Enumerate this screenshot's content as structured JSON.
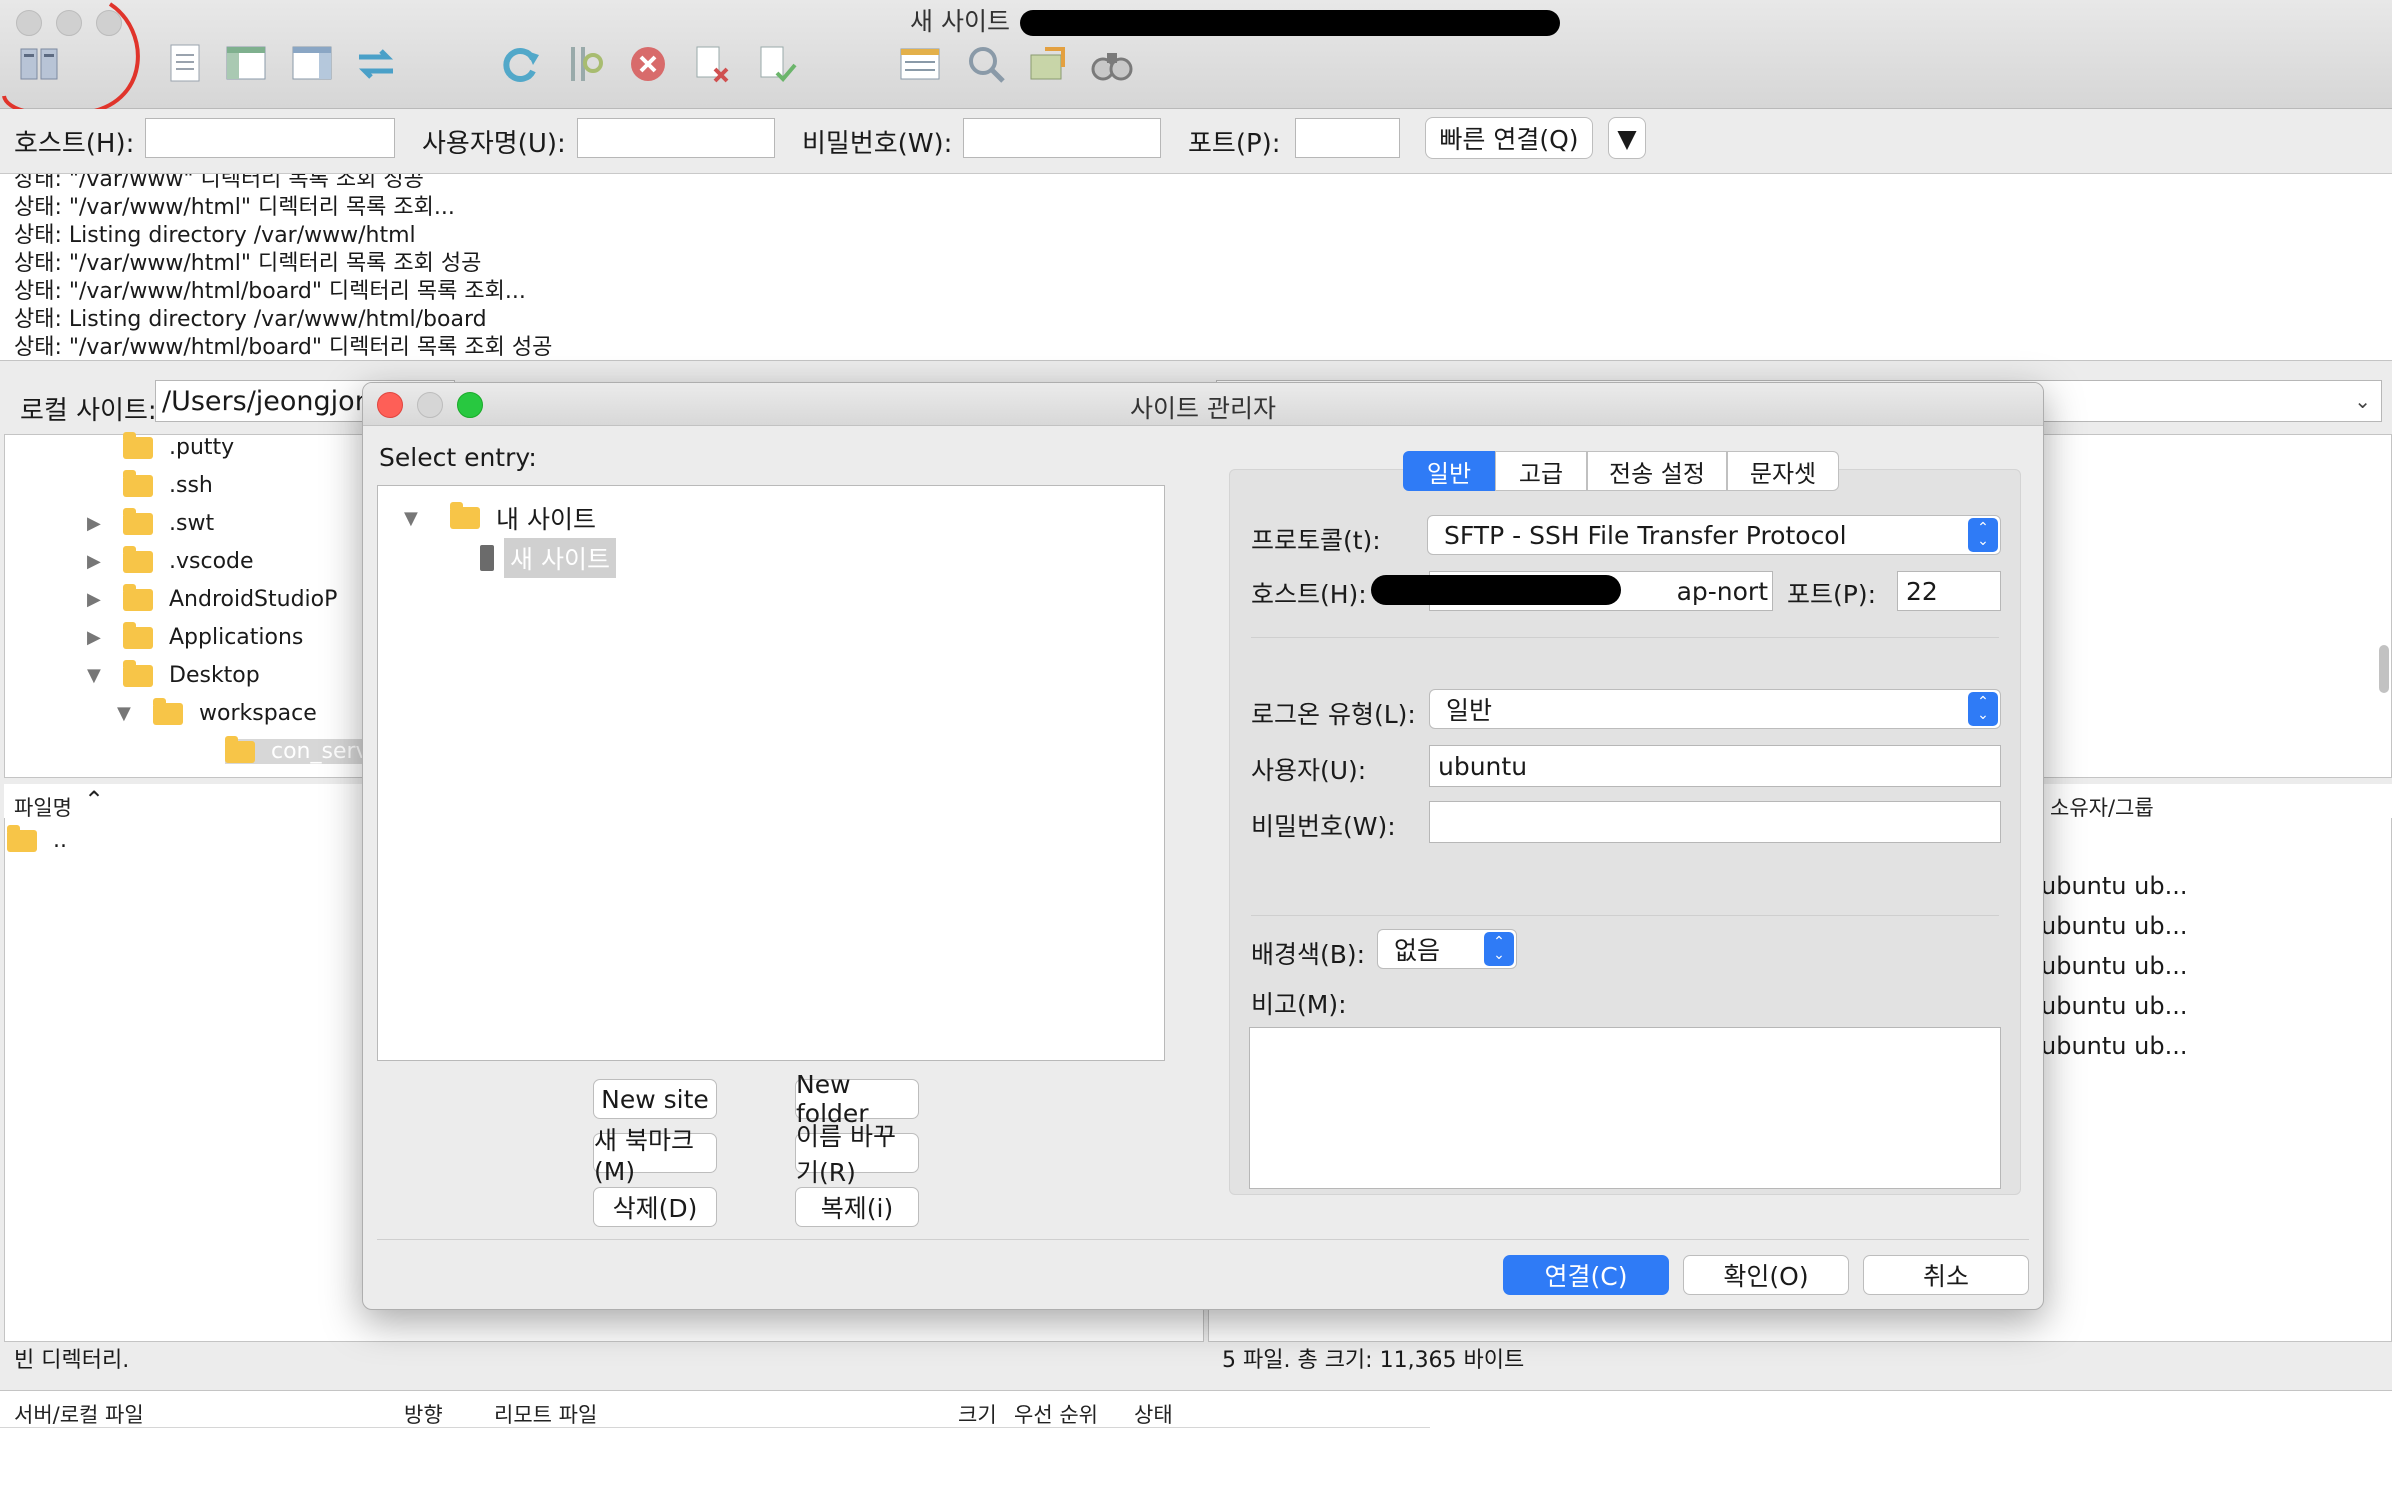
{
  "window": {
    "title": "새 사이트"
  },
  "toolbar": {
    "icons": [
      "site-manager-icon",
      "message-log-icon",
      "local-tree-icon",
      "remote-tree-icon",
      "transfer-queue-icon",
      "refresh-icon",
      "process-queue-icon",
      "cancel-icon",
      "disconnect-icon",
      "reconnect-icon",
      "directory-listing-filter-icon",
      "compare-icon",
      "sync-browse-icon",
      "find-files-icon"
    ]
  },
  "quickconnect": {
    "host_label": "호스트(H):",
    "user_label": "사용자명(U):",
    "password_label": "비밀번호(W):",
    "port_label": "포트(P):",
    "connect_button": "빠른 연결(Q)",
    "host_value": "",
    "user_value": "",
    "password_value": "",
    "port_value": ""
  },
  "log": [
    "상태:  \"/var/www\" 디렉터리 목록 조회 성공",
    "상태:  \"/var/www/html\" 디렉터리 목록 조회...",
    "상태:  Listing directory /var/www/html",
    "상태:  \"/var/www/html\" 디렉터리 목록 조회 성공",
    "상태:  \"/var/www/html/board\" 디렉터리 목록 조회...",
    "상태:  Listing directory /var/www/html/board",
    "상태:  \"/var/www/html/board\" 디렉터리 목록 조회 성공"
  ],
  "local": {
    "site_label": "로컬 사이트:",
    "path": "/Users/jeongjong",
    "tree": [
      {
        "label": ".putty",
        "arrow": ""
      },
      {
        "label": ".ssh",
        "arrow": ""
      },
      {
        "label": ".swt",
        "arrow": "▶"
      },
      {
        "label": ".vscode",
        "arrow": "▶"
      },
      {
        "label": "AndroidStudioP",
        "arrow": "▶"
      },
      {
        "label": "Applications",
        "arrow": "▶"
      },
      {
        "label": "Desktop",
        "arrow": "▼"
      },
      {
        "label": "workspace",
        "arrow": "▼"
      },
      {
        "label": "con_serve",
        "arrow": ""
      }
    ],
    "filename_header": "파일명",
    "parent_dir": "..",
    "status": "빈 디렉터리."
  },
  "remote": {
    "owner_header": "소유자/그룹",
    "owners": [
      "ubuntu ub...",
      "ubuntu ub...",
      "ubuntu ub...",
      "ubuntu ub...",
      "ubuntu ub..."
    ],
    "status": "5 파일. 총 크기: 11,365 바이트"
  },
  "queue": {
    "headers": [
      "서버/로컬 파일",
      "방향",
      "리모트 파일",
      "크기",
      "우선 순위",
      "상태"
    ]
  },
  "site_manager": {
    "title": "사이트 관리자",
    "select_entry": "Select entry:",
    "root_folder": "내 사이트",
    "selected_site": "새 사이트",
    "buttons": {
      "new_site": "New site",
      "new_folder": "New folder",
      "new_bookmark": "새 북마크(M)",
      "rename": "이름 바꾸기(R)",
      "delete": "삭제(D)",
      "duplicate": "복제(i)"
    },
    "tabs": [
      "일반",
      "고급",
      "전송 설정",
      "문자셋"
    ],
    "active_tab": 0,
    "protocol_label": "프로토콜(t):",
    "protocol_value": "SFTP - SSH File Transfer Protocol",
    "host_label": "호스트(H):",
    "host_value": "ap-nort",
    "port_label": "포트(P):",
    "port_value": "22",
    "logon_label": "로그온 유형(L):",
    "logon_value": "일반",
    "user_label": "사용자(U):",
    "user_value": "ubuntu",
    "password_label": "비밀번호(W):",
    "password_value": "",
    "bgcolor_label": "배경색(B):",
    "bgcolor_value": "없음",
    "comments_label": "비고(M):",
    "comments_value": "",
    "connect_button": "연결(C)",
    "ok_button": "확인(O)",
    "cancel_button": "취소"
  },
  "colors": {
    "accent": "#2f7bf6",
    "annotation": "#e0342b"
  }
}
